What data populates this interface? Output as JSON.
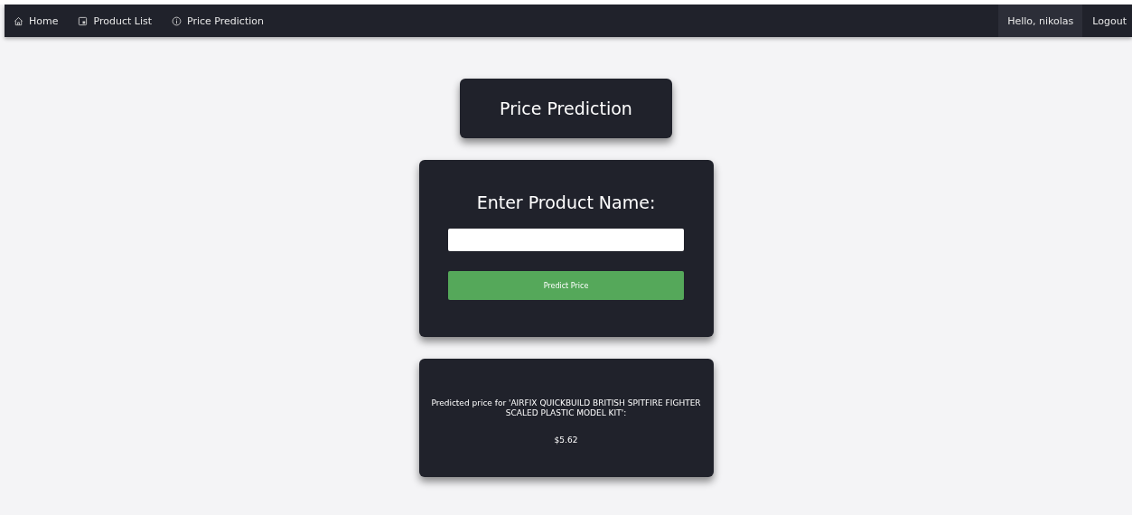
{
  "navbar": {
    "links": [
      {
        "label": "Home",
        "kind": "home"
      },
      {
        "label": "Product List",
        "kind": "list"
      },
      {
        "label": "Price Prediction",
        "kind": "info"
      }
    ],
    "greeting": "Hello, nikolas",
    "logout": "Logout"
  },
  "title": "Price Prediction",
  "form": {
    "heading": "Enter Product Name:",
    "button": "Predict Price"
  },
  "result": {
    "message": "Predicted price for 'AIRFIX QUICKBUILD BRITISH SPITFIRE FIGHTER SCALED PLASTIC MODEL KIT':",
    "price": "$5.62"
  }
}
